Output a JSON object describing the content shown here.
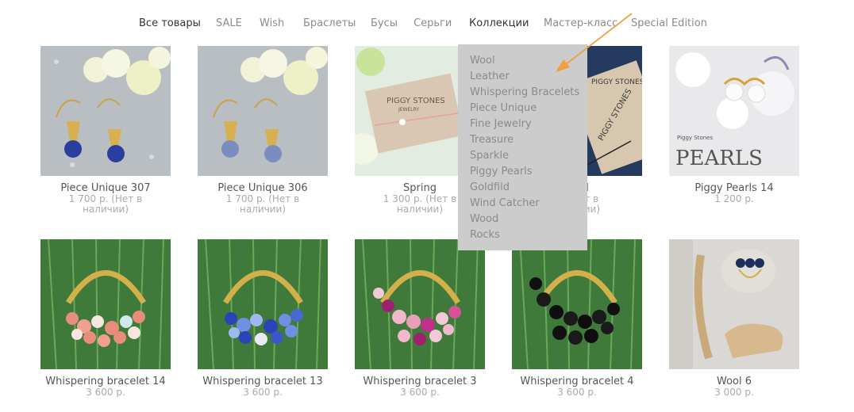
{
  "nav": {
    "items": [
      "Все товары",
      "SALE",
      "Wish",
      "Браслеты",
      "Бусы",
      "Серьги",
      "Коллекции",
      "Мастер-класс",
      "Special Edition"
    ]
  },
  "dropdown": {
    "items": [
      "Wool",
      "Leather",
      "Whispering Bracelets",
      "Piece Unique",
      "Fine Jewelry",
      "Treasure",
      "Sparkle",
      "Piggy Pearls",
      "Goldfild",
      "Wind Catcher",
      "Wood",
      "Rocks"
    ]
  },
  "products": [
    {
      "title": "Piece Unique 307",
      "price": "1 700 р. (Нет в",
      "price2": "наличии)"
    },
    {
      "title": "Piece Unique 306",
      "price": "1 700 р. (Нет в",
      "price2": "наличии)"
    },
    {
      "title": "Spring",
      "price": "1 300 р. (Нет в",
      "price2": "наличии)"
    },
    {
      "title": "Gold",
      "price": "р. (Нет в",
      "price2": "наличии)"
    },
    {
      "title": "Piggy Pearls 14",
      "price": "1 200 р.",
      "price2": ""
    },
    {
      "title": "Whispering bracelet 14",
      "price": "3 600 р.",
      "price2": ""
    },
    {
      "title": "Whispering bracelet 13",
      "price": "3 600 р.",
      "price2": ""
    },
    {
      "title": "Whispering bracelet 3",
      "price": "3 600 р.",
      "price2": ""
    },
    {
      "title": "Whispering bracelet 4",
      "price": "3 600 р.",
      "price2": ""
    },
    {
      "title": "Wool 6",
      "price": "3 000 р.",
      "price2": ""
    }
  ],
  "image_text": {
    "card_brand": "PIGGY STONES",
    "card_sub": "JEWELRY",
    "pearls_brand": "Piggy Stones",
    "pearls_word": "PEARLS"
  },
  "colors": {
    "accent_arrow": "#f0a040",
    "dropdown_bg": "#cccccc",
    "nav_active": "#333333"
  }
}
